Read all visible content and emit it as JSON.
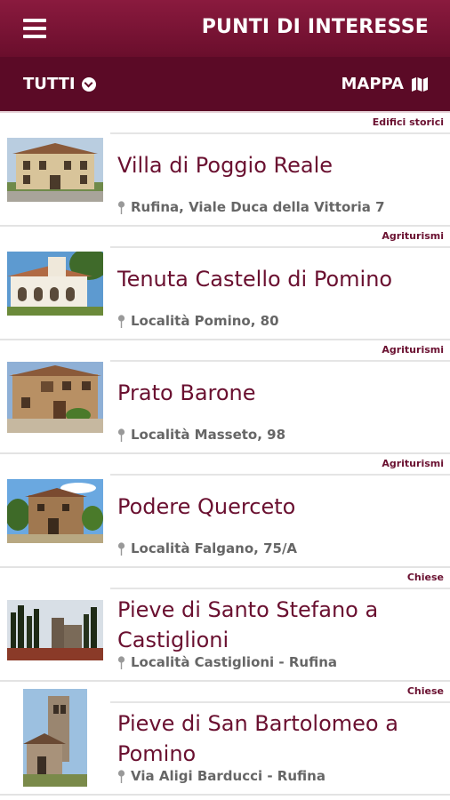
{
  "header": {
    "title": "PUNTI DI INTERESSE",
    "menu_icon": "hamburger-menu-icon",
    "background": "#7a1436"
  },
  "filterbar": {
    "filter_label": "TUTTI",
    "filter_icon": "chevron-down-circle-icon",
    "map_label": "MAPPA",
    "map_icon": "folded-map-icon",
    "background": "#5b0a26"
  },
  "accent_color": "#6a1030",
  "items": [
    {
      "category": "Edifici storici",
      "name": "Villa di Poggio Reale",
      "address": "Rufina, Viale Duca della Vittoria 7"
    },
    {
      "category": "Agriturismi",
      "name": "Tenuta Castello di Pomino",
      "address": "Località Pomino, 80"
    },
    {
      "category": "Agriturismi",
      "name": "Prato Barone",
      "address": "Località Masseto, 98"
    },
    {
      "category": "Agriturismi",
      "name": "Podere Querceto",
      "address": "Località Falgano, 75/A"
    },
    {
      "category": "Chiese",
      "name": "Pieve di Santo Stefano a Castiglioni",
      "address": "Località Castiglioni - Rufina"
    },
    {
      "category": "Chiese",
      "name": "Pieve di San Bartolomeo a Pomino",
      "address": "Via Aligi Barducci - Rufina"
    }
  ]
}
